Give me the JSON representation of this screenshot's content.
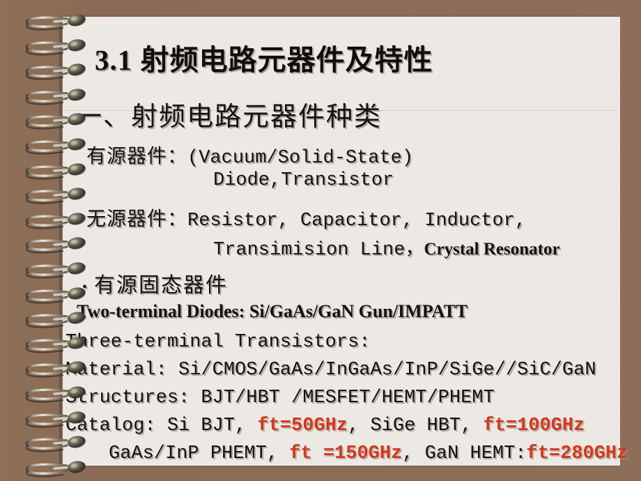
{
  "slide": {
    "title": "3.1 射频电路元器件及特性",
    "subtitle": "一、射频电路元器件种类",
    "colors": {
      "cover": "#8d6e58",
      "paper": "#ece8e4",
      "rule": "#ddd3ae",
      "text": "#141210",
      "accent_red": "#d6381a"
    },
    "body": {
      "active_label": "有源器件：",
      "active_value": "(Vacuum/Solid-State)",
      "active_cont": "Diode,Transistor",
      "passive_label": "无源器件：",
      "passive_value": "Resistor, Capacitor, Inductor,",
      "passive_cont": "Transimision Line，",
      "passive_cont_bold": "Crystal Resonator",
      "bullet_label": "有源固态器件",
      "bullet_glyph": "•",
      "two_terminal": "Two-terminal Diodes: Si/GaAs/GaN Gun/IMPATT",
      "three_terminal": "Three-terminal Transistors:",
      "material": "Material:   Si/CMOS/GaAs/InGaAs/InP/SiGe//SiC/GaN",
      "structures": "Structures: BJT/HBT /MESFET/HEMT/PHEMT",
      "catalog_pre": "Catalog: Si BJT, ",
      "catalog_ft1": "ft=50GHz",
      "catalog_mid": ", SiGe HBT, ",
      "catalog_ft2": "ft=100GHz",
      "catalog2_pre": "GaAs/InP PHEMT, ",
      "catalog2_ft1": "ft =150GHz",
      "catalog2_mid": ", GaN HEMT:",
      "catalog2_ft2": "ft=280GHz"
    }
  },
  "binding": {
    "ring_count": 19,
    "ring_label": "spiral-ring"
  }
}
